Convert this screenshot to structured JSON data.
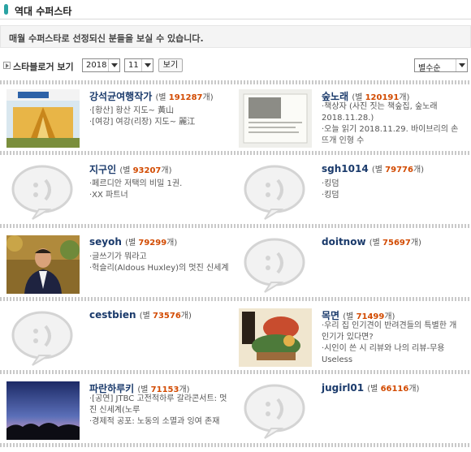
{
  "header": {
    "title": "역대 수퍼스타"
  },
  "notice": {
    "text": "매월 수퍼스타로 선정되신 분들을 보실 수 있습니다."
  },
  "filter": {
    "label": "스타블로거 보기",
    "year": "2018",
    "month": "11",
    "view_button": "보기",
    "sort": "별수순"
  },
  "colors": {
    "accent": "#2aa3a3",
    "name": "#1a3a6b",
    "count": "#d24a00"
  },
  "stars": [
    {
      "name": "강석균여행작가",
      "count_prefix": "(별 ",
      "count": "191287",
      "count_suffix": "개)",
      "lines": [
        "·[황산] 황산 지도~ 黃山",
        "·[여강] 여강(리장) 지도~ 麗江"
      ],
      "thumb": "bangkok-book-cover"
    },
    {
      "name": "숲노래",
      "count_prefix": "(별 ",
      "count": "120191",
      "count_suffix": "개)",
      "lines": [
        "·책상자 (사진 짓는 책숲집, 숲노래 2018.11.28.)",
        "·오늘 읽기 2018.11.29. 바이브리의 손뜨개 인형 수"
      ],
      "thumb": "book-page-photo"
    },
    {
      "name": "지구인",
      "count_prefix": "(별 ",
      "count": "93207",
      "count_suffix": "개)",
      "lines": [
        "·페르디안 저택의 비밀 1권.",
        "·XX 파트너"
      ],
      "thumb": "default-speech-bubble"
    },
    {
      "name": "sgh1014",
      "count_prefix": "(별 ",
      "count": "79776",
      "count_suffix": "개)",
      "lines": [
        "·킹덤",
        "·킹덤"
      ],
      "thumb": "default-speech-bubble"
    },
    {
      "name": "seyoh",
      "count_prefix": "(별 ",
      "count": "79299",
      "count_suffix": "개)",
      "lines": [
        "·글쓰기가 뭐라고",
        "·헉슬리(Aldous Huxley)의 멋진 신세계"
      ],
      "thumb": "man-portrait"
    },
    {
      "name": "doitnow",
      "count_prefix": "(별 ",
      "count": "75697",
      "count_suffix": "개)",
      "lines": [],
      "thumb": "default-speech-bubble"
    },
    {
      "name": "cestbien",
      "count_prefix": "(별 ",
      "count": "73576",
      "count_suffix": "개)",
      "lines": [],
      "thumb": "default-speech-bubble"
    },
    {
      "name": "목면",
      "count_prefix": "(별 ",
      "count": "71499",
      "count_suffix": "개)",
      "lines": [
        "·우리 집 인기견이 반려견들의 특별한 개인기가 있다면?",
        "·시인이 쓴 시 리뷰와 나의 리뷰-무용 Useless"
      ],
      "thumb": "illustration-painting"
    },
    {
      "name": "파란하루키",
      "count_prefix": "(별 ",
      "count": "71153",
      "count_suffix": "개)",
      "lines": [
        "·[공연] JTBC 고전적하루 갈라콘서트: 멋진 신세계(노루",
        "·경제적 공포: 노동의 소멸과 잉여 존재"
      ],
      "thumb": "sunset-photo"
    },
    {
      "name": "jugirl01",
      "count_prefix": "(별 ",
      "count": "66116",
      "count_suffix": "개)",
      "lines": [],
      "thumb": "default-speech-bubble"
    }
  ]
}
